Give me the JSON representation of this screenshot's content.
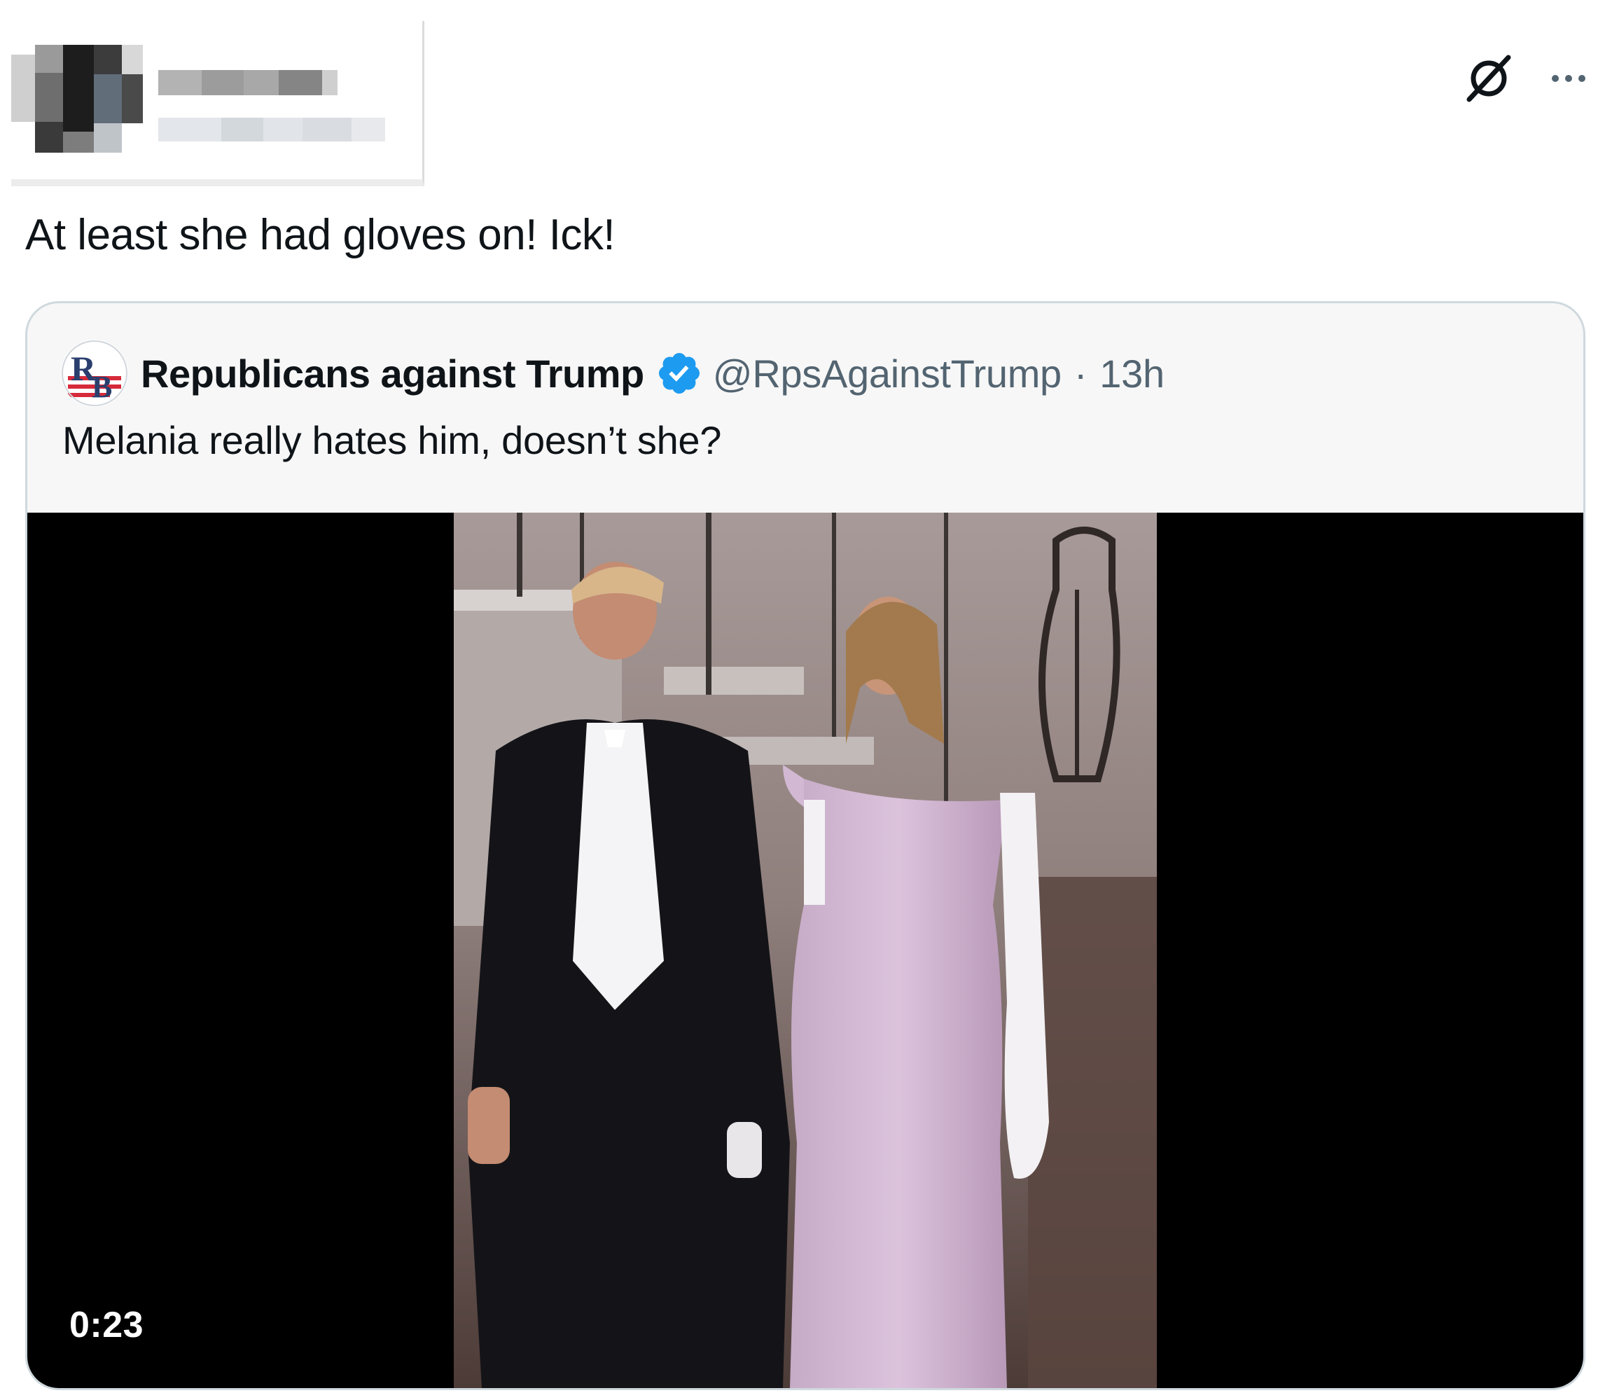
{
  "tweet": {
    "text": "At least she had gloves on! Ick!"
  },
  "header_icons": {
    "grok": "grok-slash-icon",
    "more": "more-dots-icon"
  },
  "quoted_tweet": {
    "display_name": "Republicans against Trump",
    "handle": "@RpsAgainstTrump",
    "separator": "·",
    "timestamp": "13h",
    "text": "Melania really hates him, doesn’t she?",
    "avatar_icon": "rb-logo-avatar",
    "verified_icon": "verified-badge-icon",
    "media": {
      "type": "video",
      "duration": "0:23"
    }
  },
  "colors": {
    "text": "#0f1419",
    "secondary_text": "#536471",
    "verified_blue": "#1d9bf0",
    "card_background": "#f7f7f7",
    "card_border": "#cfd9de"
  }
}
